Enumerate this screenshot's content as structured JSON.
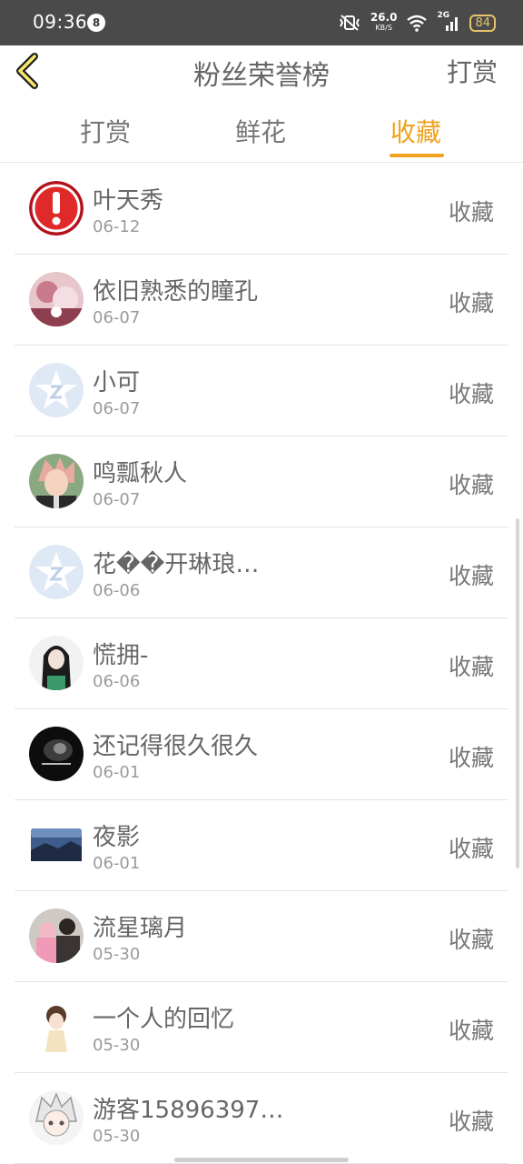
{
  "status": {
    "time": "09:36",
    "notification_count": "8",
    "speed_value": "26.0",
    "speed_unit": "KB/S",
    "network_label": "2G",
    "battery": "84"
  },
  "header": {
    "title": "粉丝荣誉榜",
    "action": "打赏"
  },
  "tabs": [
    {
      "label": "打赏"
    },
    {
      "label": "鲜花"
    },
    {
      "label": "收藏",
      "active": true
    }
  ],
  "colors": {
    "accent": "#f0a21e",
    "text": "#666666",
    "subtext": "#9a9a9a"
  },
  "rows": [
    {
      "name": "叶天秀",
      "date": "06-12",
      "action": "收藏",
      "avatar": "alert-avatar"
    },
    {
      "name": "依旧熟悉的瞳孔",
      "date": "06-07",
      "action": "收藏",
      "avatar": "photo-avatar"
    },
    {
      "name": "小可",
      "date": "06-07",
      "action": "收藏",
      "avatar": "default-avatar"
    },
    {
      "name": "鸣瓢秋人",
      "date": "06-07",
      "action": "收藏",
      "avatar": "anime-avatar"
    },
    {
      "name": "花��开琳琅…",
      "date": "06-06",
      "action": "收藏",
      "avatar": "default-avatar"
    },
    {
      "name": "慌拥-",
      "date": "06-06",
      "action": "收藏",
      "avatar": "photo-avatar"
    },
    {
      "name": "还记得很久很久",
      "date": "06-01",
      "action": "收藏",
      "avatar": "dark-photo-avatar"
    },
    {
      "name": "夜影",
      "date": "06-01",
      "action": "收藏",
      "avatar": "landscape-avatar"
    },
    {
      "name": "流星璃月",
      "date": "05-30",
      "action": "收藏",
      "avatar": "photo-avatar"
    },
    {
      "name": "一个人的回忆",
      "date": "05-30",
      "action": "收藏",
      "avatar": "illustration-avatar"
    },
    {
      "name": "游客15896397…",
      "date": "05-30",
      "action": "收藏",
      "avatar": "anime-avatar"
    }
  ]
}
